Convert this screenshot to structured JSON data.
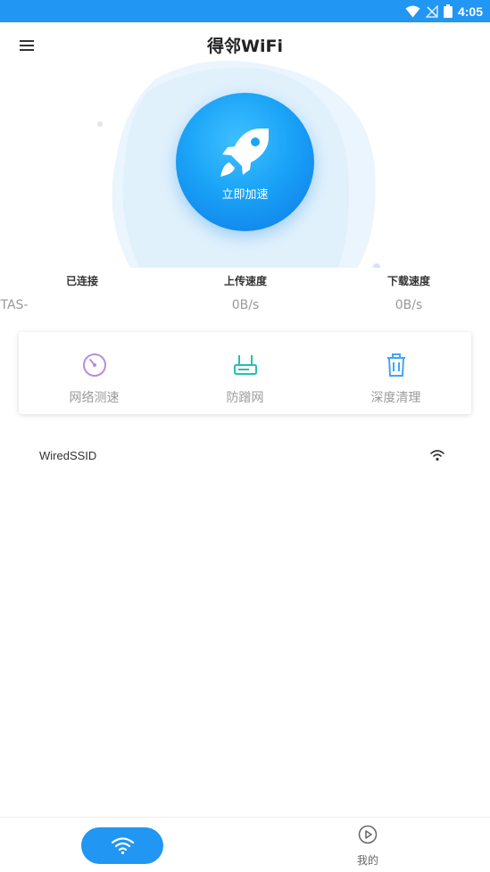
{
  "status_bar": {
    "time": "4:05"
  },
  "app_bar": {
    "title": "得邻WiFi"
  },
  "hero": {
    "boost_label": "立即加速"
  },
  "stats": [
    {
      "label": "已连接",
      "value": "TAS-"
    },
    {
      "label": "上传速度",
      "value": "0B/s"
    },
    {
      "label": "下载速度",
      "value": "0B/s"
    }
  ],
  "tools": [
    {
      "label": "网络测速",
      "icon": "speedometer-icon",
      "color": "#b48ee0"
    },
    {
      "label": "防蹭网",
      "icon": "router-icon",
      "color": "#26bfb2"
    },
    {
      "label": "深度清理",
      "icon": "trash-icon",
      "color": "#42a5f5"
    }
  ],
  "network": {
    "ssid": "WiredSSID"
  },
  "bottom_nav": {
    "mine_label": "我的"
  },
  "colors": {
    "primary": "#2196f3",
    "boost_gradient_start": "#3fc1ff",
    "boost_gradient_end": "#0d79e6"
  }
}
